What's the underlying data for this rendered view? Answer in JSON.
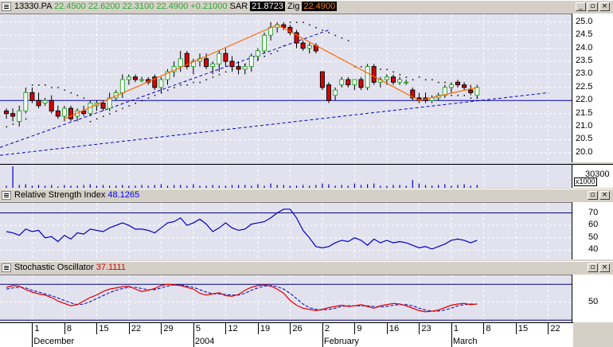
{
  "price_panel": {
    "symbol": "13330.PA",
    "quote_values": [
      "22.4500",
      "22.6200",
      "22.3100",
      "22.4900",
      "+0.21000"
    ],
    "sar_label": "SAR",
    "sar_value": "21.8723",
    "zig_label": "Zig",
    "zig_value": "22.4900",
    "y_ticks": [
      "25.0",
      "24.5",
      "24.0",
      "23.5",
      "23.0",
      "22.5",
      "22.0",
      "21.5",
      "21.0",
      "20.5",
      "20.0"
    ]
  },
  "volume_panel": {
    "tick": "30300",
    "multiplier": "x1000"
  },
  "rsi_panel": {
    "title": "Relative Strength Index",
    "value": "48.1265",
    "y_ticks": [
      "70",
      "60",
      "50",
      "40"
    ]
  },
  "stoch_panel": {
    "title": "Stochastic Oscillator",
    "value": "37.1111",
    "y_ticks": [
      "50"
    ]
  },
  "x_axis": {
    "day_labels": [
      "1",
      "8",
      "15",
      "22",
      "29",
      "5",
      "12",
      "19",
      "26",
      "2",
      "9",
      "16",
      "23",
      "1",
      "8",
      "15",
      "22"
    ],
    "month_labels": [
      "December",
      "2004",
      "February",
      "March"
    ]
  },
  "window_buttons": {
    "minimize": "_",
    "restore": "▫",
    "close": "×"
  },
  "colors": {
    "plot_bg": "#e2e2ef",
    "up_candle": "#ffffff",
    "down_candle": "#e00000",
    "zigzag": "#ff6a00",
    "trendline": "#0000c0",
    "rsi_line": "#0000c0",
    "stoch_k": "#e00000",
    "stoch_d": "#0000c0"
  },
  "chart_data": {
    "type": "candlestick",
    "x_range_labels": [
      "December",
      "2004",
      "February",
      "March"
    ],
    "ylim": [
      19.6,
      25.3
    ],
    "candles_ohlc": [
      [
        21.6,
        21.7,
        21.3,
        21.5
      ],
      [
        21.5,
        21.7,
        21.2,
        21.4
      ],
      [
        21.2,
        21.8,
        21.0,
        21.6
      ],
      [
        21.6,
        22.5,
        21.5,
        22.3
      ],
      [
        22.3,
        22.5,
        21.9,
        22.0
      ],
      [
        22.0,
        22.3,
        21.7,
        21.8
      ],
      [
        21.9,
        22.1,
        21.8,
        22.0
      ],
      [
        22.0,
        22.2,
        21.5,
        21.6
      ],
      [
        21.6,
        21.8,
        21.3,
        21.4
      ],
      [
        21.4,
        21.8,
        21.2,
        21.7
      ],
      [
        21.7,
        21.8,
        21.2,
        21.3
      ],
      [
        21.4,
        21.7,
        21.2,
        21.6
      ],
      [
        21.6,
        21.8,
        21.4,
        21.5
      ],
      [
        21.5,
        22.0,
        21.4,
        21.9
      ],
      [
        21.8,
        22.0,
        21.6,
        21.9
      ],
      [
        21.9,
        22.0,
        21.6,
        21.7
      ],
      [
        21.7,
        22.3,
        21.6,
        22.1
      ],
      [
        22.1,
        22.4,
        22.0,
        22.3
      ],
      [
        22.3,
        23.0,
        22.1,
        22.8
      ],
      [
        22.8,
        23.0,
        22.6,
        22.9
      ],
      [
        22.9,
        23.0,
        22.7,
        22.8
      ],
      [
        22.8,
        22.9,
        22.7,
        22.8
      ],
      [
        22.8,
        22.9,
        22.6,
        22.7
      ],
      [
        22.9,
        23.0,
        22.4,
        22.5
      ],
      [
        22.5,
        22.9,
        22.3,
        22.8
      ],
      [
        22.8,
        23.2,
        22.6,
        23.1
      ],
      [
        23.1,
        23.5,
        22.9,
        23.3
      ],
      [
        23.3,
        23.9,
        23.1,
        23.6
      ],
      [
        23.8,
        23.9,
        23.2,
        23.3
      ],
      [
        23.3,
        23.6,
        23.0,
        23.5
      ],
      [
        23.5,
        23.8,
        23.3,
        23.6
      ],
      [
        23.6,
        23.8,
        23.2,
        23.3
      ],
      [
        23.3,
        23.5,
        23.0,
        23.4
      ],
      [
        23.4,
        23.9,
        23.1,
        23.8
      ],
      [
        23.8,
        24.0,
        23.3,
        23.5
      ],
      [
        23.5,
        23.7,
        23.1,
        23.3
      ],
      [
        23.3,
        23.5,
        23.0,
        23.2
      ],
      [
        23.2,
        23.4,
        23.0,
        23.3
      ],
      [
        23.3,
        23.8,
        23.1,
        23.7
      ],
      [
        23.7,
        24.0,
        23.5,
        23.9
      ],
      [
        23.9,
        24.6,
        23.8,
        24.5
      ],
      [
        24.5,
        25.0,
        24.3,
        24.8
      ],
      [
        24.8,
        25.0,
        24.6,
        24.9
      ],
      [
        24.9,
        25.0,
        24.7,
        24.8
      ],
      [
        24.8,
        24.9,
        24.5,
        24.6
      ],
      [
        24.6,
        24.7,
        24.0,
        24.2
      ],
      [
        24.2,
        24.3,
        23.9,
        24.0
      ],
      [
        24.0,
        24.2,
        23.8,
        24.1
      ],
      [
        24.1,
        24.2,
        23.8,
        23.9
      ],
      [
        23.1,
        23.1,
        22.4,
        22.5
      ],
      [
        22.6,
        22.7,
        21.9,
        22.0
      ],
      [
        22.2,
        22.5,
        22.0,
        22.4
      ],
      [
        22.6,
        22.9,
        22.5,
        22.8
      ],
      [
        22.8,
        22.9,
        22.5,
        22.6
      ],
      [
        22.6,
        22.8,
        22.4,
        22.8
      ],
      [
        22.8,
        22.9,
        22.4,
        22.5
      ],
      [
        22.5,
        23.4,
        22.4,
        23.3
      ],
      [
        23.3,
        23.4,
        22.6,
        22.7
      ],
      [
        22.7,
        22.9,
        22.5,
        22.8
      ],
      [
        22.8,
        23.0,
        22.6,
        22.9
      ],
      [
        22.9,
        23.0,
        22.6,
        22.7
      ],
      [
        22.7,
        22.9,
        22.6,
        22.8
      ],
      [
        22.7,
        22.8,
        22.6,
        22.7
      ],
      [
        22.4,
        22.5,
        22.0,
        22.1
      ],
      [
        22.1,
        22.3,
        21.9,
        22.0
      ],
      [
        22.1,
        22.3,
        21.9,
        22.0
      ],
      [
        22.0,
        22.2,
        21.9,
        22.1
      ],
      [
        22.1,
        22.3,
        22.0,
        22.2
      ],
      [
        22.2,
        22.6,
        22.1,
        22.5
      ],
      [
        22.5,
        22.7,
        22.3,
        22.6
      ],
      [
        22.7,
        22.8,
        22.5,
        22.6
      ],
      [
        22.6,
        22.7,
        22.4,
        22.5
      ],
      [
        22.4,
        22.6,
        22.2,
        22.3
      ],
      [
        22.2,
        22.6,
        22.1,
        22.5
      ]
    ],
    "sar_dots": [
      21.0,
      21.1,
      21.2,
      21.3,
      22.6,
      22.6,
      22.6,
      22.5,
      22.5,
      22.4,
      22.3,
      22.2,
      22.1,
      21.2,
      21.3,
      21.4,
      21.5,
      21.6,
      21.7,
      21.8,
      21.9,
      22.0,
      22.1,
      22.2,
      22.3,
      22.4,
      22.5,
      22.6,
      22.6,
      22.7,
      22.7,
      22.8,
      22.9,
      23.0,
      23.1,
      23.2,
      23.3,
      23.4,
      23.5,
      23.6,
      23.7,
      23.8,
      23.9,
      24.1,
      25.0,
      25.0,
      25.0,
      24.9,
      24.8,
      24.7,
      24.6,
      24.5,
      24.4,
      24.3,
      23.3,
      23.3,
      23.3,
      23.3,
      23.2,
      23.2,
      23.1,
      23.0,
      22.9,
      22.8,
      22.9,
      22.8,
      22.8,
      22.7,
      22.7,
      22.2,
      22.2,
      22.2,
      22.1,
      22.1
    ],
    "zigzag_points": [
      [
        9,
        21.3
      ],
      [
        42,
        24.9
      ],
      [
        64,
        22.0
      ],
      [
        73,
        22.5
      ]
    ],
    "support_lines": [
      {
        "from": [
          0,
          22.0
        ],
        "to": [
          73,
          22.0
        ]
      },
      {
        "from": [
          0,
          19.9
        ],
        "to": [
          73,
          22.2
        ]
      },
      {
        "from": [
          0,
          20.2
        ],
        "to": [
          50,
          24.7
        ]
      }
    ],
    "volume": [
      3,
      30,
      4,
      5,
      3,
      4,
      3,
      4,
      2,
      4,
      3,
      3,
      4,
      5,
      3,
      4,
      3,
      3,
      4,
      3,
      3,
      4,
      3,
      4,
      5,
      3,
      4,
      4,
      3,
      5,
      3,
      3,
      4,
      3,
      3,
      4,
      4,
      4,
      3,
      5,
      3,
      6,
      4,
      4,
      3,
      3,
      4,
      3,
      4,
      6,
      5,
      3,
      4,
      3,
      6,
      4,
      5,
      6,
      3,
      3,
      4,
      4,
      3,
      11,
      6,
      4,
      3,
      4,
      5,
      3,
      4,
      5,
      3,
      4
    ],
    "rsi": [
      55,
      54,
      52,
      57,
      55,
      56,
      50,
      51,
      47,
      52,
      49,
      54,
      53,
      57,
      56,
      55,
      58,
      60,
      62,
      60,
      57,
      57,
      56,
      54,
      58,
      62,
      63,
      66,
      60,
      62,
      65,
      61,
      55,
      58,
      62,
      58,
      56,
      57,
      61,
      62,
      63,
      66,
      70,
      73,
      73,
      66,
      56,
      50,
      43,
      42,
      43,
      46,
      48,
      47,
      50,
      48,
      44,
      49,
      46,
      48,
      46,
      47,
      46,
      44,
      42,
      43,
      41,
      43,
      45,
      48,
      49,
      48,
      46,
      48
    ],
    "stoch_k": [
      75,
      78,
      77,
      71,
      67,
      64,
      62,
      58,
      52,
      48,
      44,
      46,
      52,
      58,
      62,
      68,
      72,
      74,
      76,
      77,
      72,
      68,
      70,
      73,
      78,
      80,
      79,
      78,
      75,
      72,
      65,
      62,
      64,
      66,
      61,
      60,
      63,
      70,
      75,
      78,
      79,
      77,
      72,
      65,
      53,
      45,
      40,
      38,
      36,
      38,
      41,
      43,
      45,
      43,
      44,
      46,
      43,
      40,
      44,
      46,
      48,
      47,
      44,
      40,
      36,
      34,
      35,
      37,
      41,
      45,
      47,
      48,
      46,
      47
    ],
    "stoch_d": [
      72,
      74,
      75,
      74,
      70,
      67,
      64,
      61,
      57,
      53,
      49,
      46,
      47,
      51,
      56,
      61,
      66,
      70,
      73,
      75,
      75,
      73,
      71,
      71,
      74,
      77,
      79,
      79,
      77,
      75,
      71,
      67,
      64,
      64,
      63,
      62,
      62,
      65,
      70,
      74,
      77,
      78,
      76,
      72,
      65,
      56,
      47,
      41,
      38,
      37,
      38,
      40,
      43,
      44,
      44,
      44,
      44,
      43,
      42,
      43,
      45,
      46,
      46,
      44,
      40,
      37,
      35,
      35,
      37,
      40,
      44,
      46,
      47,
      47
    ]
  }
}
